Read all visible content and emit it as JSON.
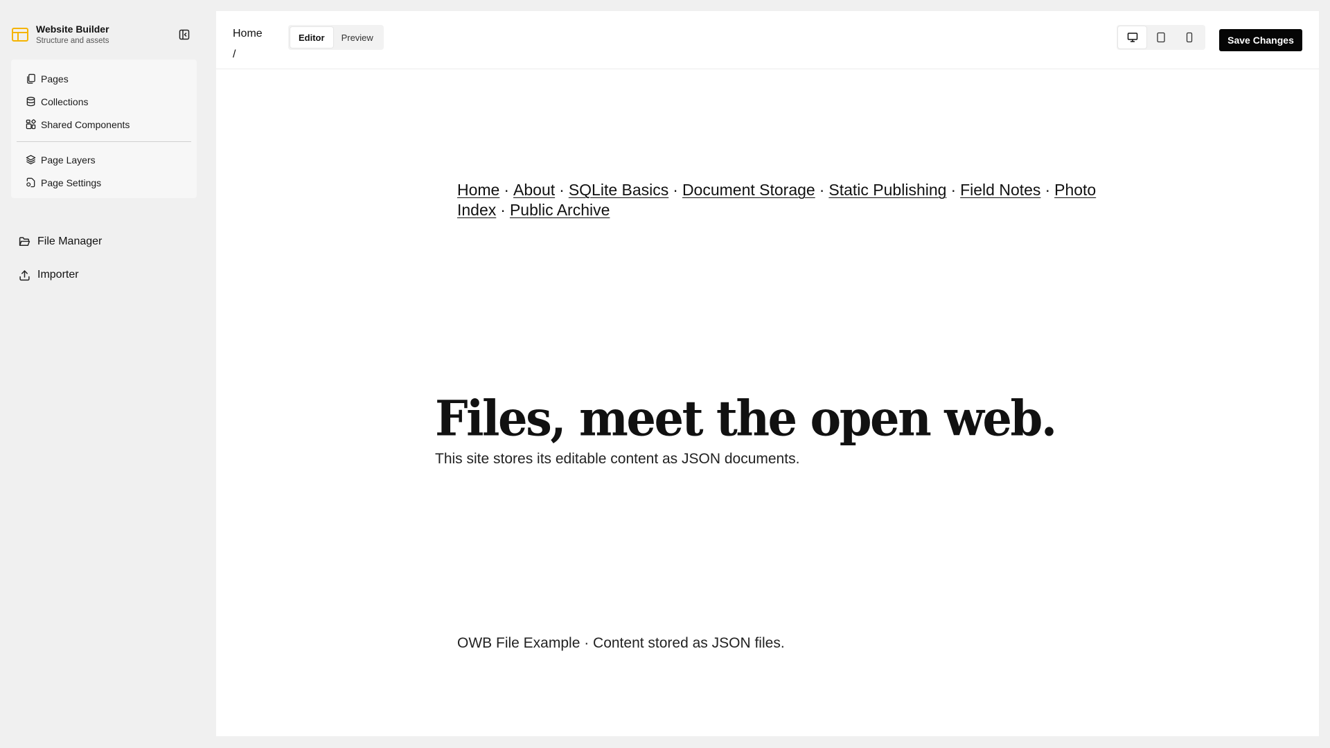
{
  "sidebar": {
    "brand": {
      "title": "Website Builder",
      "subtitle": "Structure and assets",
      "logo_icon": "layout-panel-icon",
      "logo_color": "#f5b400"
    },
    "items": [
      {
        "label": "Pages",
        "icon": "pages-icon"
      },
      {
        "label": "Collections",
        "icon": "database-icon"
      },
      {
        "label": "Shared Components",
        "icon": "components-icon"
      }
    ],
    "items2": [
      {
        "label": "Page Layers",
        "icon": "layers-icon"
      },
      {
        "label": "Page Settings",
        "icon": "page-settings-icon"
      }
    ],
    "links": [
      {
        "label": "File Manager",
        "icon": "folder-open-icon"
      },
      {
        "label": "Importer",
        "icon": "upload-icon"
      }
    ]
  },
  "header": {
    "breadcrumb": {
      "current": "Home",
      "separator": "/"
    },
    "tabs": [
      {
        "label": "Editor",
        "active": true
      },
      {
        "label": "Preview",
        "active": false
      }
    ],
    "devices": [
      "desktop-icon",
      "tablet-icon",
      "mobile-icon"
    ],
    "save_label": "Save Changes"
  },
  "canvas": {
    "nav": {
      "links": [
        "Home",
        "About",
        "SQLite Basics",
        "Document Storage",
        "Static Publishing",
        "Field Notes",
        "Photo Index",
        "Public Archive"
      ],
      "separator": "·"
    },
    "hero": {
      "title": "Files, meet the open web.",
      "subtitle": "This site stores its editable content as JSON documents."
    },
    "footer": "OWB File Example · Content stored as JSON files."
  }
}
